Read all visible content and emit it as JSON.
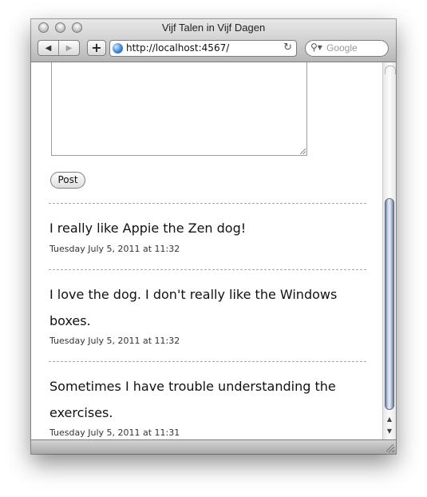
{
  "window": {
    "title": "Vijf Talen in Vijf Dagen"
  },
  "toolbar": {
    "back_icon": "back-arrow-icon",
    "forward_icon": "forward-arrow-icon",
    "add_label": "+",
    "url": "http://localhost:4567/",
    "reload_icon": "reload-icon",
    "search_placeholder": "Google"
  },
  "form": {
    "post_label": "Post"
  },
  "messages": [
    {
      "text": "I really like Appie the Zen dog!",
      "timestamp": "Tuesday July 5, 2011 at 11:32"
    },
    {
      "text": "I love the dog. I don't really like the Windows boxes.",
      "timestamp": "Tuesday July 5, 2011 at 11:32"
    },
    {
      "text": "Sometimes I have trouble understanding the exercises.",
      "timestamp": "Tuesday July 5, 2011 at 11:31"
    }
  ],
  "colors": {
    "scroll_thumb": "#b7c4dc",
    "divider": "#a8a8a8"
  }
}
